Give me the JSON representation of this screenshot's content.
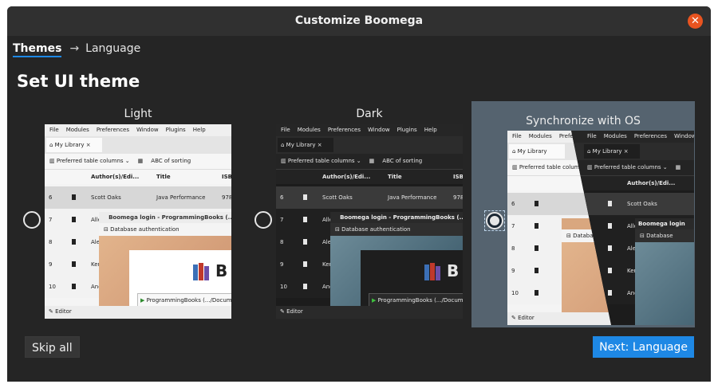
{
  "window": {
    "title": "Customize Boomega"
  },
  "breadcrumb": {
    "active": "Themes",
    "arrow": "→",
    "next": "Language"
  },
  "page": {
    "heading": "Set UI theme"
  },
  "options": [
    {
      "label": "Light",
      "selected": false
    },
    {
      "label": "Dark",
      "selected": false
    },
    {
      "label": "Synchronize with OS",
      "selected": true
    }
  ],
  "preview": {
    "menu": [
      "File",
      "Modules",
      "Preferences",
      "Window",
      "Plugins",
      "Help"
    ],
    "tab": "My Library",
    "tab_close": "×",
    "toolbar": {
      "columns": "Preferred table columns",
      "sorting": "ABC of sorting"
    },
    "columns": {
      "author": "Author(s)/Edi...",
      "title": "Title",
      "isbn": "ISB"
    },
    "rows": [
      {
        "num": "6",
        "author": "Scott Oaks",
        "title": "Java Performance",
        "isbn": "978"
      },
      {
        "num": "7",
        "author": "Allen",
        "title": "",
        "isbn": ""
      },
      {
        "num": "8",
        "author": "Alex",
        "title": "",
        "isbn": ""
      },
      {
        "num": "9",
        "author": "Ken",
        "title": "",
        "isbn": ""
      },
      {
        "num": "10",
        "author": "And",
        "title": "",
        "isbn": ""
      }
    ],
    "dialog": {
      "title": "Boomega login - ProgrammingBooks (.../D",
      "section": "Database authentication",
      "logo_text": "B",
      "field": "ProgrammingBooks (.../Docum"
    },
    "status": "Editor"
  },
  "buttons": {
    "skip": "Skip all",
    "next": "Next: Language"
  },
  "colors": {
    "accent": "#1e88e5",
    "close": "#e95420",
    "background": "#252525",
    "selected_box": "#55636f"
  }
}
